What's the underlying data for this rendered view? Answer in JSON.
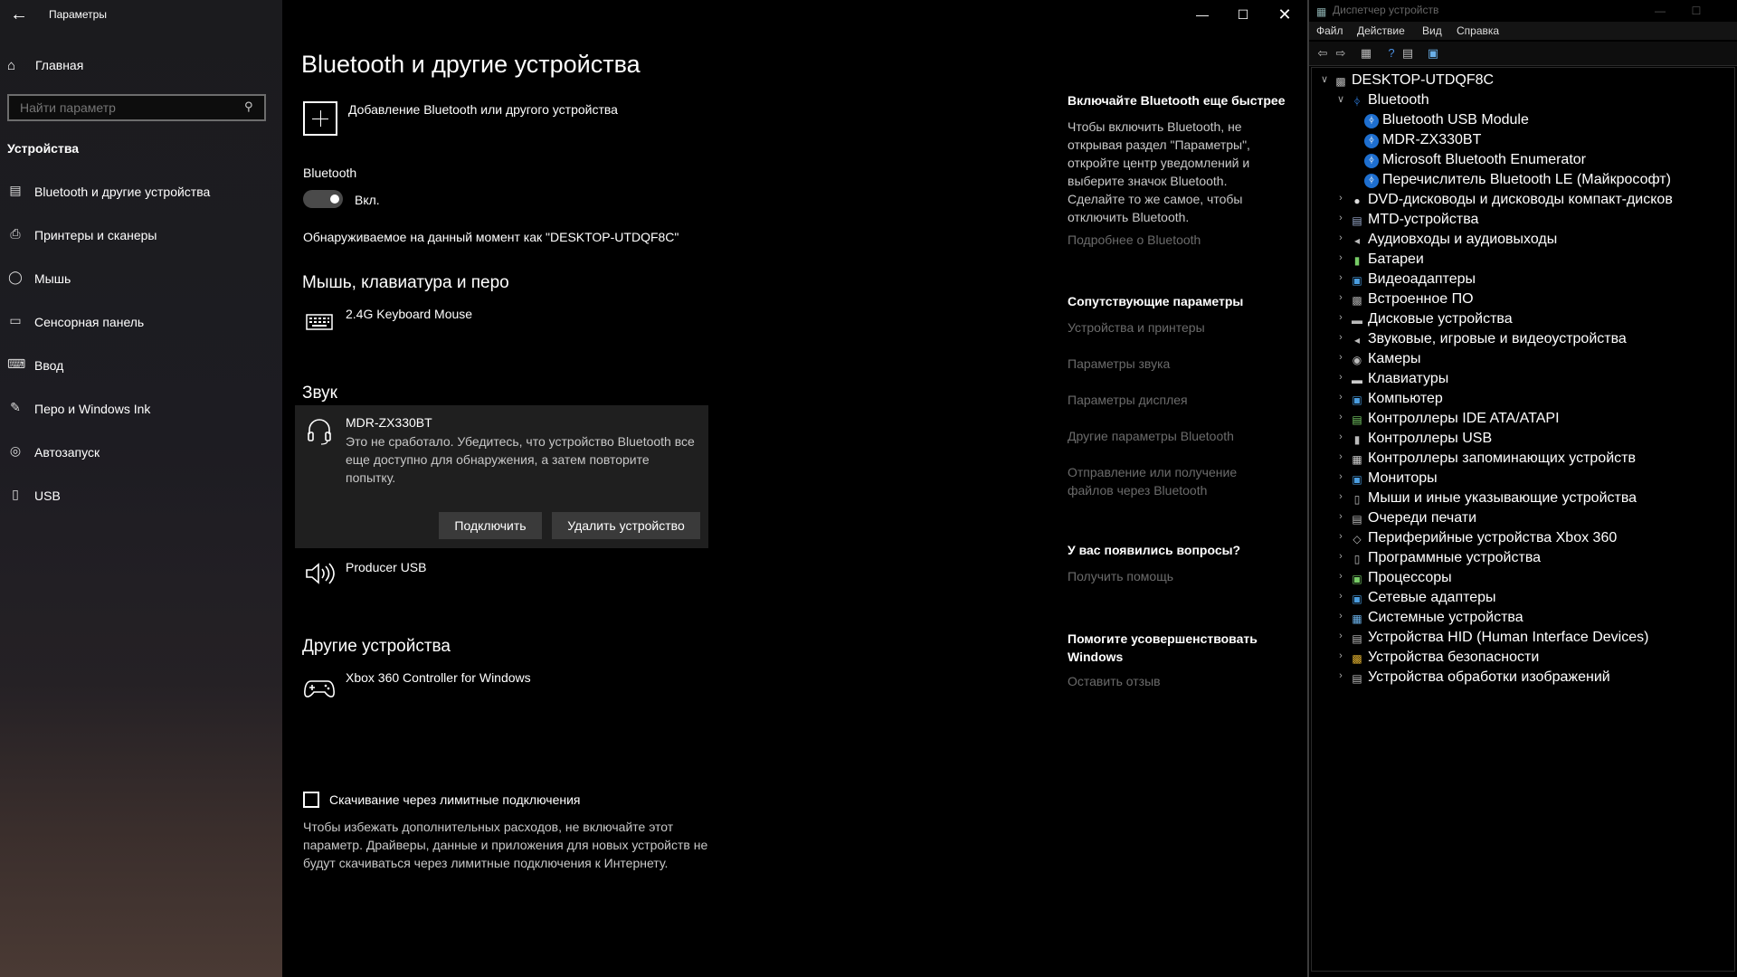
{
  "settings": {
    "window_title": "Параметры",
    "home_label": "Главная",
    "search_placeholder": "Найти параметр",
    "section_label": "Устройства",
    "nav": [
      {
        "label": "Bluetooth и другие устройства",
        "icon": "bluetooth-devices-icon"
      },
      {
        "label": "Принтеры и сканеры",
        "icon": "printer-icon"
      },
      {
        "label": "Мышь",
        "icon": "mouse-icon"
      },
      {
        "label": "Сенсорная панель",
        "icon": "touchpad-icon"
      },
      {
        "label": "Ввод",
        "icon": "keyboard-icon"
      },
      {
        "label": "Перо и Windows Ink",
        "icon": "pen-icon"
      },
      {
        "label": "Автозапуск",
        "icon": "autoplay-icon"
      },
      {
        "label": "USB",
        "icon": "usb-icon"
      }
    ],
    "page_title": "Bluetooth и другие устройства",
    "add_device_label": "Добавление Bluetooth или другого устройства",
    "bluetooth_label": "Bluetooth",
    "bluetooth_state": "Вкл.",
    "bluetooth_on": true,
    "discoverable_text": "Обнаруживаемое на данный момент как \"DESKTOP-UTDQF8C\"",
    "groups": {
      "input": {
        "title": "Мышь, клавиатура и перо",
        "devices": [
          {
            "name": "2.4G Keyboard Mouse",
            "icon": "keyboard-icon"
          }
        ]
      },
      "audio": {
        "title": "Звук",
        "selected": {
          "name": "MDR-ZX330BT",
          "icon": "headphones-icon",
          "error": "Это не сработало. Убедитесь, что устройство Bluetooth все еще доступно для обнаружения, а затем повторите попытку.",
          "connect_label": "Подключить",
          "remove_label": "Удалить устройство"
        },
        "devices": [
          {
            "name": "Producer USB",
            "icon": "speaker-icon"
          }
        ]
      },
      "other": {
        "title": "Другие устройства",
        "devices": [
          {
            "name": "Xbox 360 Controller for Windows",
            "icon": "gamepad-icon"
          }
        ]
      }
    },
    "metered": {
      "label": "Скачивание через лимитные подключения",
      "checked": false,
      "description": "Чтобы избежать дополнительных расходов, не включайте этот параметр. Драйверы, данные и приложения для новых устройств не будут скачиваться через лимитные подключения к Интернету."
    },
    "side": {
      "quick_title": "Включайте Bluetooth еще быстрее",
      "quick_text": "Чтобы включить Bluetooth, не открывая раздел \"Параметры\", откройте центр уведомлений и выберите значок Bluetooth. Сделайте то же самое, чтобы отключить Bluetooth.",
      "quick_link": "Подробнее о Bluetooth",
      "related_title": "Сопутствующие параметры",
      "related_links": [
        "Устройства и принтеры",
        "Параметры звука",
        "Параметры дисплея",
        "Другие параметры Bluetooth",
        "Отправление или получение файлов через Bluetooth"
      ],
      "questions_title": "У вас появились вопросы?",
      "questions_link": "Получить помощь",
      "improve_title": "Помогите усовершенствовать Windows",
      "improve_link": "Оставить отзыв"
    }
  },
  "devmgr": {
    "title": "Диспетчер устройств",
    "menu": [
      "Файл",
      "Действие",
      "Вид",
      "Справка"
    ],
    "root": "DESKTOP-UTDQF8C",
    "bluetooth_category": "Bluetooth",
    "bluetooth_children": [
      "Bluetooth USB Module",
      "MDR-ZX330BT",
      "Microsoft Bluetooth Enumerator",
      "Перечислитель Bluetooth LE (Майкрософт)"
    ],
    "categories": [
      "DVD-дисководы и дисководы компакт-дисков",
      "MTD-устройства",
      "Аудиовходы и аудиовыходы",
      "Батареи",
      "Видеоадаптеры",
      "Встроенное ПО",
      "Дисковые устройства",
      "Звуковые, игровые и видеоустройства",
      "Камеры",
      "Клавиатуры",
      "Компьютер",
      "Контроллеры IDE ATA/ATAPI",
      "Контроллеры USB",
      "Контроллеры запоминающих устройств",
      "Мониторы",
      "Мыши и иные указывающие устройства",
      "Очереди печати",
      "Периферийные устройства Xbox 360",
      "Программные устройства",
      "Процессоры",
      "Сетевые адаптеры",
      "Системные устройства",
      "Устройства HID (Human Interface Devices)",
      "Устройства безопасности",
      "Устройства обработки изображений"
    ]
  }
}
